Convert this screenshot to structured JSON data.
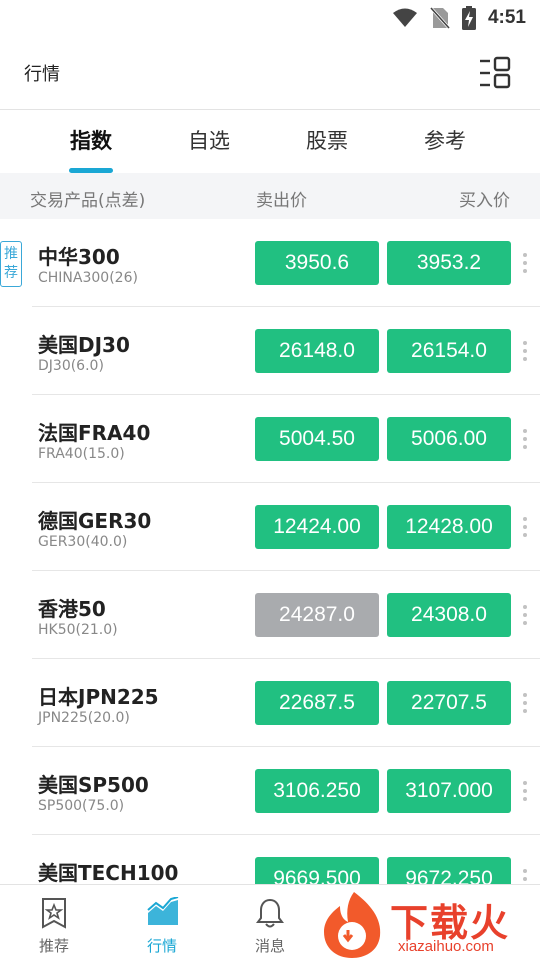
{
  "status_bar": {
    "time": "4:51"
  },
  "header": {
    "title": "行情"
  },
  "tabs": [
    {
      "label": "指数",
      "active": true
    },
    {
      "label": "自选",
      "active": false
    },
    {
      "label": "股票",
      "active": false
    },
    {
      "label": "参考",
      "active": false
    }
  ],
  "columns": {
    "product": "交易产品(点差)",
    "sell": "卖出价",
    "buy": "买入价"
  },
  "rows": [
    {
      "badge": "推荐",
      "name": "中华300",
      "code": "CHINA300(26)",
      "sell": "3950.6",
      "buy": "3953.2",
      "sell_state": "green"
    },
    {
      "name": "美国DJ30",
      "code": "DJ30(6.0)",
      "sell": "26148.0",
      "buy": "26154.0",
      "sell_state": "green"
    },
    {
      "name": "法国FRA40",
      "code": "FRA40(15.0)",
      "sell": "5004.50",
      "buy": "5006.00",
      "sell_state": "green"
    },
    {
      "name": "德国GER30",
      "code": "GER30(40.0)",
      "sell": "12424.00",
      "buy": "12428.00",
      "sell_state": "green"
    },
    {
      "name": "香港50",
      "code": "HK50(21.0)",
      "sell": "24287.0",
      "buy": "24308.0",
      "sell_state": "gray"
    },
    {
      "name": "日本JPN225",
      "code": "JPN225(20.0)",
      "sell": "22687.5",
      "buy": "22707.5",
      "sell_state": "green"
    },
    {
      "name": "美国SP500",
      "code": "SP500(75.0)",
      "sell": "3106.250",
      "buy": "3107.000",
      "sell_state": "green"
    },
    {
      "name": "美国TECH100",
      "code": "",
      "sell": "9669.500",
      "buy": "9672.250",
      "sell_state": "green"
    }
  ],
  "bottom_nav": [
    {
      "label": "推荐",
      "icon": "star-doc-icon",
      "active": false
    },
    {
      "label": "行情",
      "icon": "chart-icon",
      "active": true
    },
    {
      "label": "消息",
      "icon": "bell-icon",
      "active": false
    }
  ],
  "watermark": {
    "text": "下载火",
    "sub": "xiazaihuo.com"
  },
  "colors": {
    "accent": "#1aa7d4",
    "price_green": "#21c081",
    "price_gray": "#a9abae"
  }
}
